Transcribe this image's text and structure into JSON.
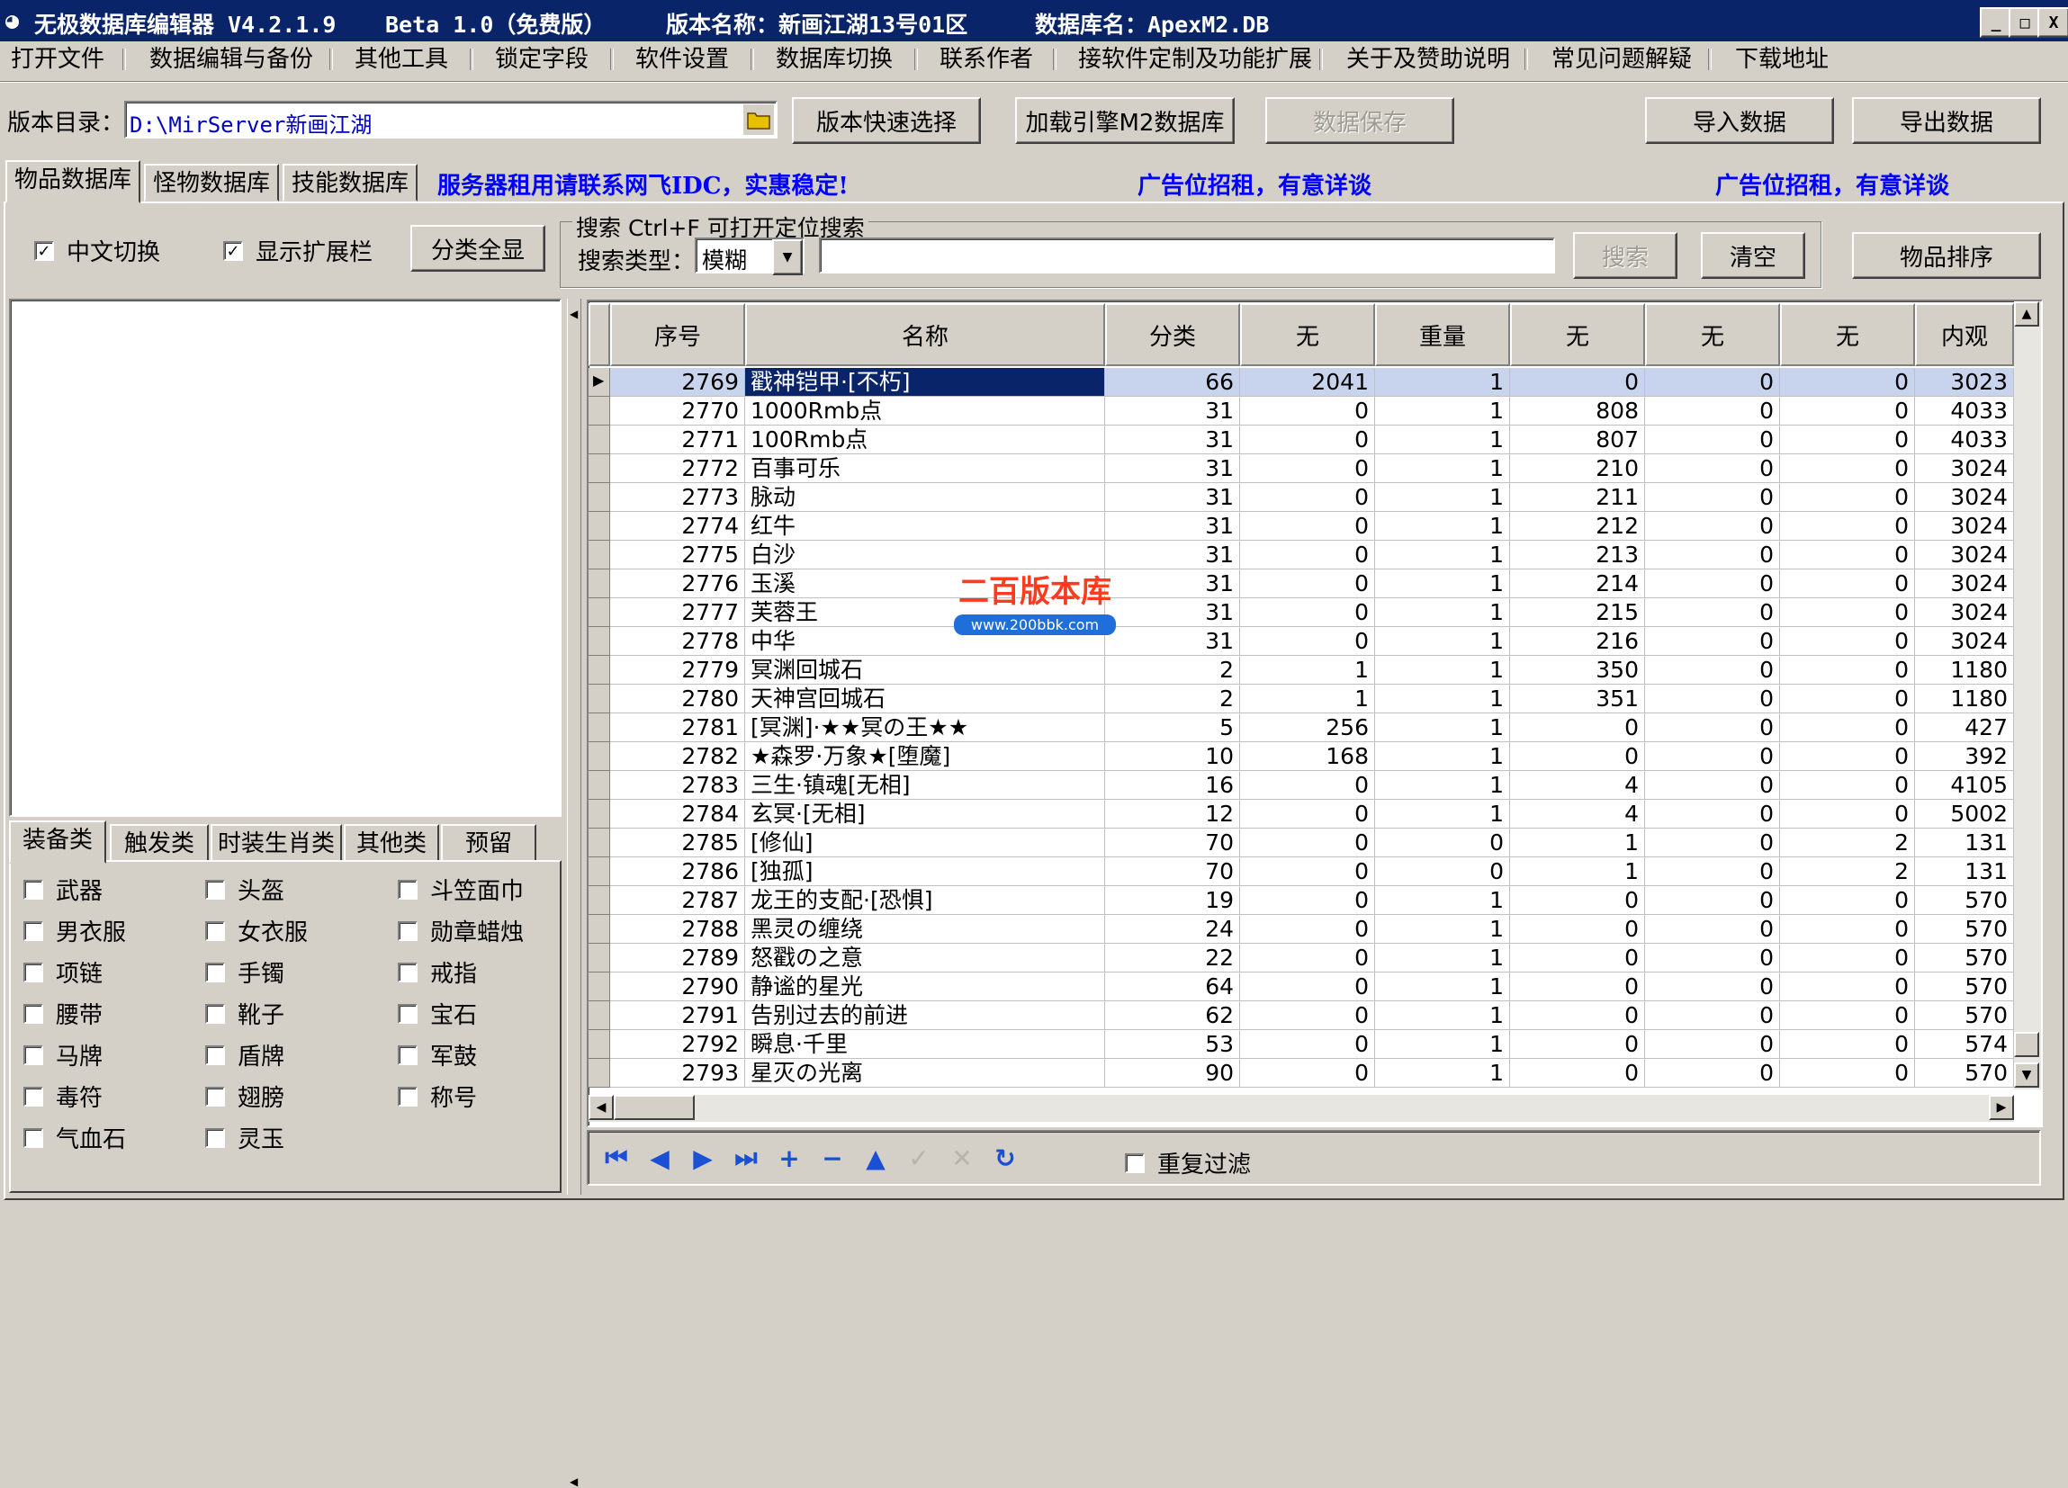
{
  "title": {
    "app": "无极数据库编辑器 V4.2.1.9",
    "beta": "Beta 1.0（免费版）",
    "version_name": "版本名称：新画江湖13号01区",
    "db_name": "数据库名：ApexM2.DB",
    "minimize": "_",
    "maximize": "□",
    "close": "X"
  },
  "menu": [
    "打开文件",
    "数据编辑与备份",
    "其他工具",
    "锁定字段",
    "软件设置",
    "数据库切换",
    "联系作者",
    "接软件定制及功能扩展",
    "关于及赞助说明",
    "常见问题解疑",
    "下载地址"
  ],
  "toolbar": {
    "dir_label": "版本目录：",
    "dir_value": "D:\\MirServer新画江湖",
    "quick_select": "版本快速选择",
    "load_db": "加载引擎M2数据库",
    "save": "数据保存",
    "import": "导入数据",
    "export": "导出数据"
  },
  "tabs": [
    "物品数据库",
    "怪物数据库",
    "技能数据库"
  ],
  "ads": [
    "服务器租用请联系网飞IDC，实惠稳定!",
    "广告位招租，有意详谈",
    "广告位招租，有意详谈"
  ],
  "options": {
    "chinese_switch": "中文切换",
    "show_ext": "显示扩展栏",
    "show_all_cat": "分类全显"
  },
  "search": {
    "group_title": "搜索  Ctrl+F 可打开定位搜索",
    "type_label": "搜索类型：",
    "type_value": "模糊",
    "search_btn": "搜索",
    "clear_btn": "清空",
    "sort_btn": "物品排序"
  },
  "category_tabs": [
    "装备类",
    "触发类",
    "时装生肖类",
    "其他类",
    "预留"
  ],
  "categories": [
    [
      "武器",
      "头盔",
      "斗笠面巾"
    ],
    [
      "男衣服",
      "女衣服",
      "勋章蜡烛"
    ],
    [
      "项链",
      "手镯",
      "戒指"
    ],
    [
      "腰带",
      "靴子",
      "宝石"
    ],
    [
      "马牌",
      "盾牌",
      "军鼓"
    ],
    [
      "毒符",
      "翅膀",
      "称号"
    ],
    [
      "气血石",
      "灵玉",
      ""
    ]
  ],
  "grid": {
    "headers": [
      "序号",
      "名称",
      "分类",
      "无",
      "重量",
      "无",
      "无",
      "无",
      "内观"
    ],
    "rows": [
      [
        "2769",
        "戳神铠甲·[不朽]",
        "66",
        "2041",
        "1",
        "0",
        "0",
        "0",
        "3023"
      ],
      [
        "2770",
        "1000Rmb点",
        "31",
        "0",
        "1",
        "808",
        "0",
        "0",
        "4033"
      ],
      [
        "2771",
        "100Rmb点",
        "31",
        "0",
        "1",
        "807",
        "0",
        "0",
        "4033"
      ],
      [
        "2772",
        "百事可乐",
        "31",
        "0",
        "1",
        "210",
        "0",
        "0",
        "3024"
      ],
      [
        "2773",
        "脉动",
        "31",
        "0",
        "1",
        "211",
        "0",
        "0",
        "3024"
      ],
      [
        "2774",
        "红牛",
        "31",
        "0",
        "1",
        "212",
        "0",
        "0",
        "3024"
      ],
      [
        "2775",
        "白沙",
        "31",
        "0",
        "1",
        "213",
        "0",
        "0",
        "3024"
      ],
      [
        "2776",
        "玉溪",
        "31",
        "0",
        "1",
        "214",
        "0",
        "0",
        "3024"
      ],
      [
        "2777",
        "芙蓉王",
        "31",
        "0",
        "1",
        "215",
        "0",
        "0",
        "3024"
      ],
      [
        "2778",
        "中华",
        "31",
        "0",
        "1",
        "216",
        "0",
        "0",
        "3024"
      ],
      [
        "2779",
        "冥渊回城石",
        "2",
        "1",
        "1",
        "350",
        "0",
        "0",
        "1180"
      ],
      [
        "2780",
        "天神宫回城石",
        "2",
        "1",
        "1",
        "351",
        "0",
        "0",
        "1180"
      ],
      [
        "2781",
        "[冥渊]·★★冥の王★★",
        "5",
        "256",
        "1",
        "0",
        "0",
        "0",
        "427"
      ],
      [
        "2782",
        "★森罗·万象★[堕魔]",
        "10",
        "168",
        "1",
        "0",
        "0",
        "0",
        "392"
      ],
      [
        "2783",
        "三生·镇魂[无相]",
        "16",
        "0",
        "1",
        "4",
        "0",
        "0",
        "4105"
      ],
      [
        "2784",
        "玄冥·[无相]",
        "12",
        "0",
        "1",
        "4",
        "0",
        "0",
        "5002"
      ],
      [
        "2785",
        "[修仙]",
        "70",
        "0",
        "0",
        "1",
        "0",
        "2",
        "131"
      ],
      [
        "2786",
        "[独孤]",
        "70",
        "0",
        "0",
        "1",
        "0",
        "2",
        "131"
      ],
      [
        "2787",
        "龙王的支配·[恐惧]",
        "19",
        "0",
        "1",
        "0",
        "0",
        "0",
        "570"
      ],
      [
        "2788",
        "黑灵の缠绕",
        "24",
        "0",
        "1",
        "0",
        "0",
        "0",
        "570"
      ],
      [
        "2789",
        "怒戳の之意",
        "22",
        "0",
        "1",
        "0",
        "0",
        "0",
        "570"
      ],
      [
        "2790",
        "静谧的星光",
        "64",
        "0",
        "1",
        "0",
        "0",
        "0",
        "570"
      ],
      [
        "2791",
        "告别过去的前进",
        "62",
        "0",
        "1",
        "0",
        "0",
        "0",
        "570"
      ],
      [
        "2792",
        "瞬息·千里",
        "53",
        "0",
        "1",
        "0",
        "0",
        "0",
        "574"
      ],
      [
        "2793",
        "星灭の光离",
        "90",
        "0",
        "1",
        "0",
        "0",
        "0",
        "570"
      ]
    ]
  },
  "watermark": {
    "main": "二百版本库",
    "url": "www.200bbk.com"
  },
  "repeat_filter": "重复过滤",
  "colors": {
    "titlebar": "#0a246a",
    "face": "#d4d0c8",
    "ad": "#0000ff",
    "nav": "#1a4fd6",
    "watermark": "#ff3b1f"
  }
}
